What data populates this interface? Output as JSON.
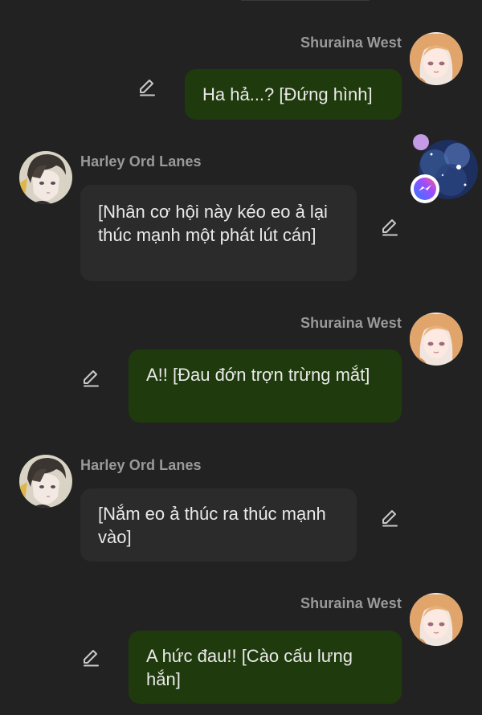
{
  "messages": [
    {
      "sender": "Shuraina West",
      "text": "Ha hả...? [Đứng hình]"
    },
    {
      "sender": "Harley Ord Lanes",
      "text": "[Nhân cơ hội này kéo eo ả lại thúc mạnh một phát lút cán]"
    },
    {
      "sender": "Shuraina West",
      "text": "A!! [Đau đớn trợn trừng mắt]"
    },
    {
      "sender": "Harley Ord Lanes",
      "text": "[Nắm eo ả thúc ra thúc mạnh vào]"
    },
    {
      "sender": "Shuraina West",
      "text": "A hức đau!! [Cào cấu lưng hắn]"
    }
  ],
  "icons": {
    "edit": "pencil-edit-icon",
    "chat_head_badge": "messenger-icon"
  },
  "colors": {
    "background": "#222222",
    "outgoing_bubble": "#1f3a0c",
    "incoming_bubble": "#2b2b2b",
    "sender_name": "#9a9a9a",
    "message_text": "#e9e9e9",
    "chat_head_dot": "#c39ae6"
  }
}
